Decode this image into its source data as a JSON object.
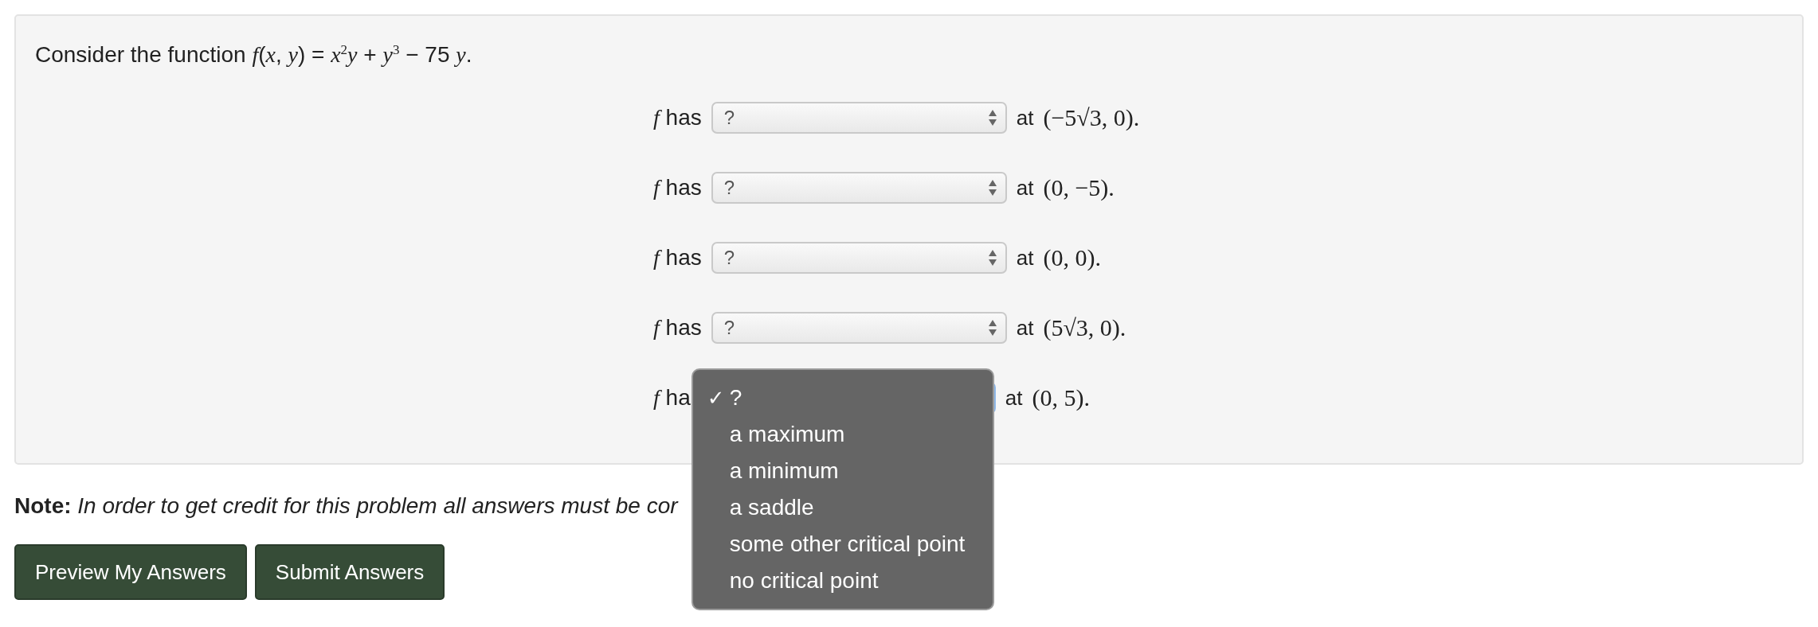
{
  "problem": {
    "intro": "Consider the function *f*(*x*, *y*) = *x*$^{2}$*y* + *y*$^{3}$ − 75 *y*.",
    "rows": [
      {
        "label": "*f* has",
        "select": {
          "value": "?",
          "focused": false
        },
        "at": "at",
        "point": "(−5√3, 0)."
      },
      {
        "label": "*f* has",
        "select": {
          "value": "?",
          "focused": false
        },
        "at": "at",
        "point": "(0, −5)."
      },
      {
        "label": "*f* has",
        "select": {
          "value": "?",
          "focused": false
        },
        "at": "at",
        "point": "(0, 0)."
      },
      {
        "label": "*f* has",
        "select": {
          "value": "?",
          "focused": false
        },
        "at": "at",
        "point": "(5√3, 0)."
      },
      {
        "label": "*f* ha",
        "select": {
          "focused": true,
          "open": true
        },
        "at": "at",
        "point": "(0, 5)."
      }
    ]
  },
  "dropdown": {
    "check_mark": "✓",
    "options": [
      {
        "label": "?",
        "selected": true
      },
      {
        "label": "a maximum",
        "selected": false
      },
      {
        "label": "a minimum",
        "selected": false
      },
      {
        "label": "a saddle",
        "selected": false
      },
      {
        "label": "some other critical point",
        "selected": false
      },
      {
        "label": "no critical point",
        "selected": false
      }
    ]
  },
  "note": "**Note:** *In order to get credit for this problem all answers must be cor*",
  "buttons": [
    "Preview My Answers",
    "Submit Answers"
  ]
}
